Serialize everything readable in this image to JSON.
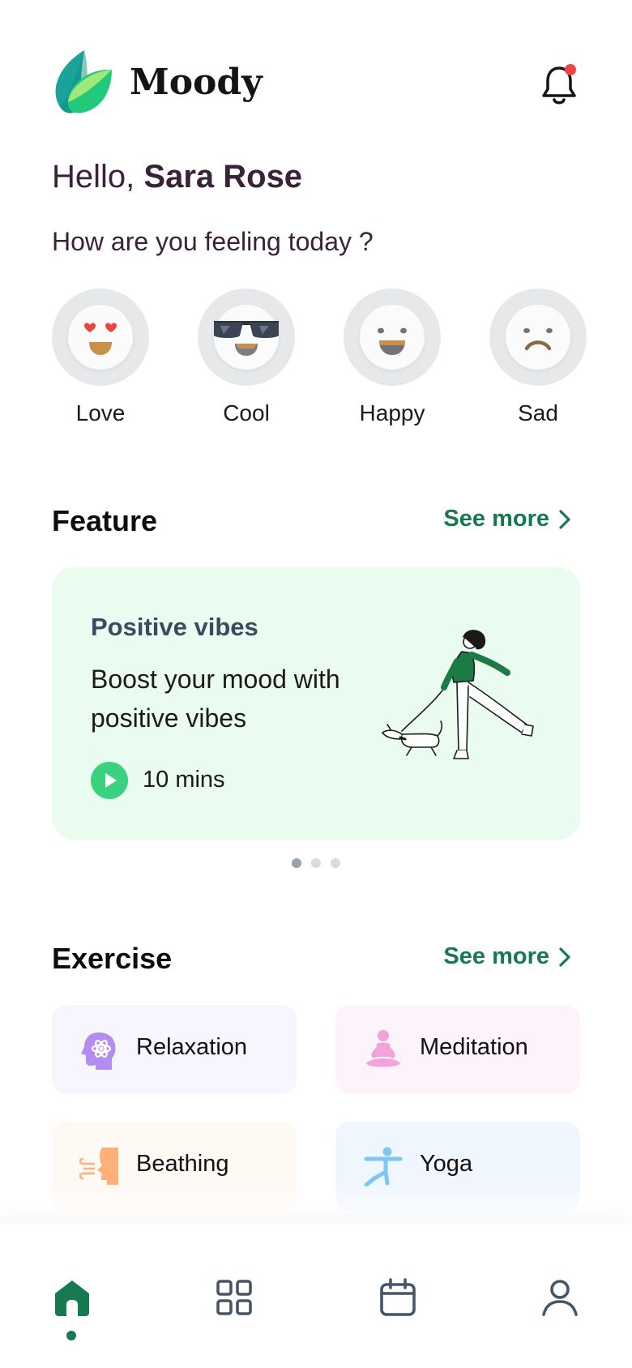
{
  "app": {
    "name": "Moody"
  },
  "greeting": {
    "prefix": "Hello, ",
    "user_name": "Sara Rose"
  },
  "mood_question": "How are you feeling today ?",
  "moods": [
    {
      "label": "Love",
      "icon": "love-face-icon"
    },
    {
      "label": "Cool",
      "icon": "cool-face-icon"
    },
    {
      "label": "Happy",
      "icon": "happy-face-icon"
    },
    {
      "label": "Sad",
      "icon": "sad-face-icon"
    }
  ],
  "feature": {
    "section_title": "Feature",
    "see_more": "See more",
    "card": {
      "title": "Positive vibes",
      "description": "Boost your mood with positive vibes",
      "duration": "10 mins",
      "illustration": "woman-walking-dog-illustration"
    },
    "pager": {
      "count": 3,
      "active": 1
    }
  },
  "exercise": {
    "section_title": "Exercise",
    "see_more": "See more",
    "items": [
      {
        "label": "Relaxation",
        "icon": "head-atom-icon"
      },
      {
        "label": "Meditation",
        "icon": "meditation-icon"
      },
      {
        "label": "Beathing",
        "icon": "breathing-icon"
      },
      {
        "label": "Yoga",
        "icon": "yoga-icon"
      }
    ]
  },
  "bottom_nav": [
    {
      "name": "home",
      "icon": "home-icon",
      "active": true
    },
    {
      "name": "apps",
      "icon": "grid-icon",
      "active": false
    },
    {
      "name": "calendar",
      "icon": "calendar-icon",
      "active": false
    },
    {
      "name": "profile",
      "icon": "user-icon",
      "active": false
    }
  ],
  "colors": {
    "accent_green": "#157a4f",
    "greeting_text": "#3a2238",
    "feature_card_bg": "#eafbef",
    "play_button": "#3ad27f",
    "relaxation_bg": "#f7f5fe",
    "meditation_bg": "#fdf3fa",
    "breathing_bg": "#fff9f3",
    "yoga_bg": "#eff6fe",
    "notification_dot": "#ef4444"
  }
}
